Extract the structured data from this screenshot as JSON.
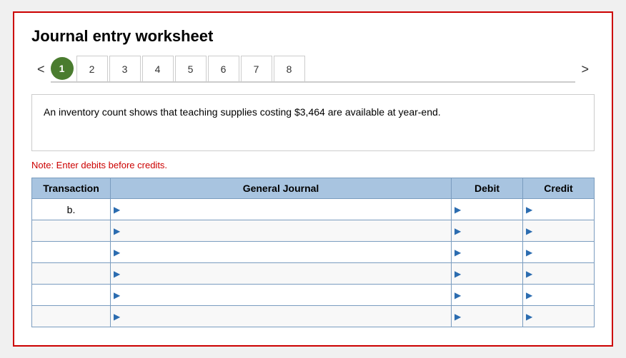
{
  "page": {
    "title": "Journal entry worksheet",
    "border_color": "#cc0000"
  },
  "nav": {
    "prev_arrow": "<",
    "next_arrow": ">",
    "tabs": [
      {
        "label": "1",
        "active": true
      },
      {
        "label": "2",
        "active": false
      },
      {
        "label": "3",
        "active": false
      },
      {
        "label": "4",
        "active": false
      },
      {
        "label": "5",
        "active": false
      },
      {
        "label": "6",
        "active": false
      },
      {
        "label": "7",
        "active": false
      },
      {
        "label": "8",
        "active": false
      }
    ]
  },
  "description": "An inventory count shows that teaching supplies costing $3,464 are available at year-end.",
  "note": "Note: Enter debits before credits.",
  "table": {
    "headers": {
      "transaction": "Transaction",
      "general_journal": "General Journal",
      "debit": "Debit",
      "credit": "Credit"
    },
    "rows": [
      {
        "transaction": "b.",
        "general_journal": "",
        "debit": "",
        "credit": ""
      },
      {
        "transaction": "",
        "general_journal": "",
        "debit": "",
        "credit": ""
      },
      {
        "transaction": "",
        "general_journal": "",
        "debit": "",
        "credit": ""
      },
      {
        "transaction": "",
        "general_journal": "",
        "debit": "",
        "credit": ""
      },
      {
        "transaction": "",
        "general_journal": "",
        "debit": "",
        "credit": ""
      },
      {
        "transaction": "",
        "general_journal": "",
        "debit": "",
        "credit": ""
      }
    ]
  }
}
